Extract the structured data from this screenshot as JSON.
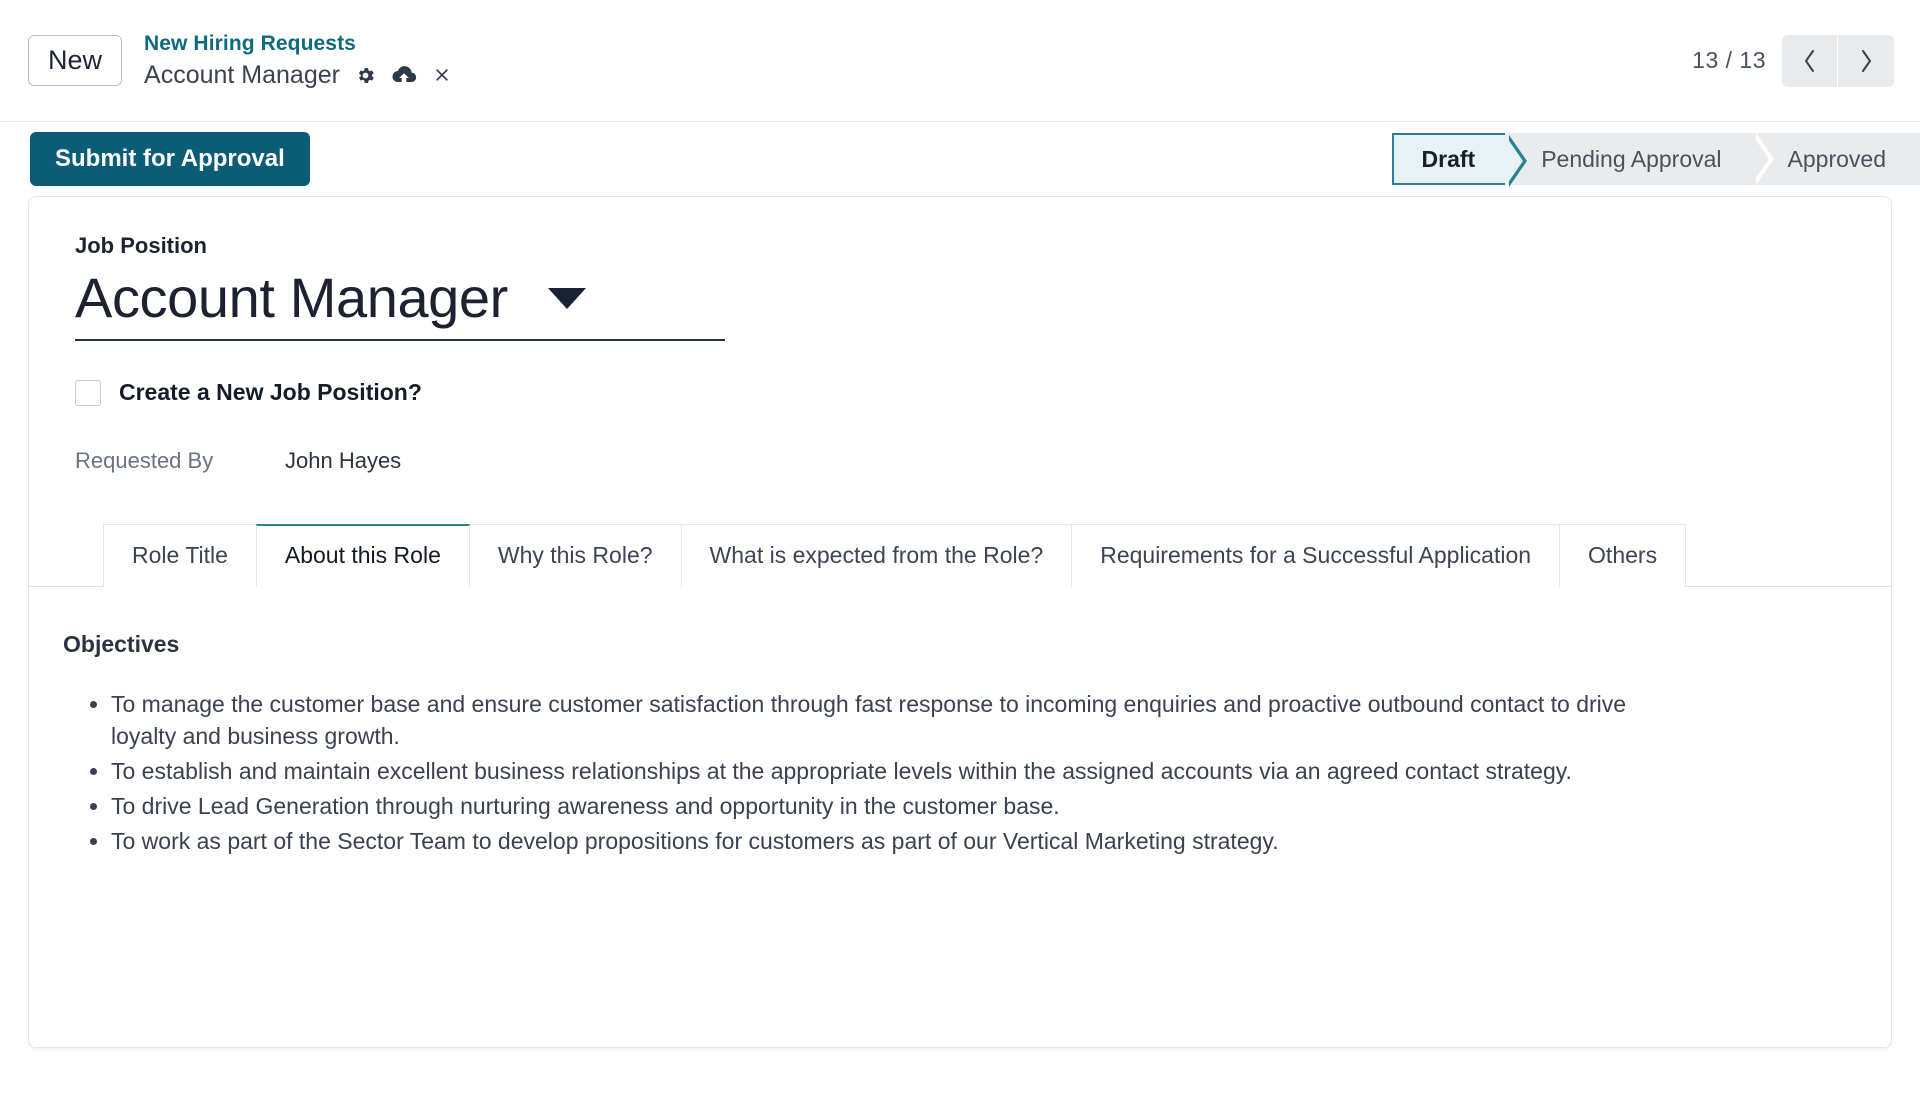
{
  "header": {
    "new_badge": "New",
    "breadcrumb_parent": "New Hiring Requests",
    "record_name": "Account Manager",
    "icons": {
      "settings": "gear-icon",
      "save": "cloud-upload-icon",
      "discard": "close-icon"
    },
    "pager": {
      "count": "13 / 13",
      "prev": "chevron-left-icon",
      "next": "chevron-right-icon"
    }
  },
  "action_bar": {
    "primary_button": "Submit for Approval",
    "statusbar": [
      {
        "label": "Draft",
        "active": true
      },
      {
        "label": "Pending Approval",
        "active": false
      },
      {
        "label": "Approved",
        "active": false
      }
    ]
  },
  "form": {
    "job_position_label": "Job Position",
    "job_position_value": "Account Manager",
    "create_new_checkbox_label": "Create a New Job Position?",
    "create_new_checkbox_checked": false,
    "requested_by_label": "Requested By",
    "requested_by_value": "John Hayes"
  },
  "tabs": [
    {
      "label": "Role Title",
      "active": false
    },
    {
      "label": "About this Role",
      "active": true
    },
    {
      "label": "Why this Role?",
      "active": false
    },
    {
      "label": "What is expected from the Role?",
      "active": false
    },
    {
      "label": "Requirements for a Successful Application",
      "active": false
    },
    {
      "label": "Others",
      "active": false
    }
  ],
  "about_this_role": {
    "section_title": "Objectives",
    "objectives": [
      "To manage the customer base and ensure customer satisfaction through fast response to incoming enquiries and proactive outbound contact to drive loyalty and business growth.",
      "To establish and maintain excellent business relationships at the appropriate levels within the assigned accounts via an agreed contact strategy.",
      "To drive Lead Generation through nurturing awareness and opportunity in the customer base.",
      "To work as part of the Sector Team to develop propositions for customers as part of our Vertical Marketing strategy."
    ]
  },
  "colors": {
    "accent": "#0d6a7f",
    "primary_button": "#0b5d77",
    "status_active_border": "#2b8296",
    "status_inactive_bg": "#e9ebed"
  }
}
